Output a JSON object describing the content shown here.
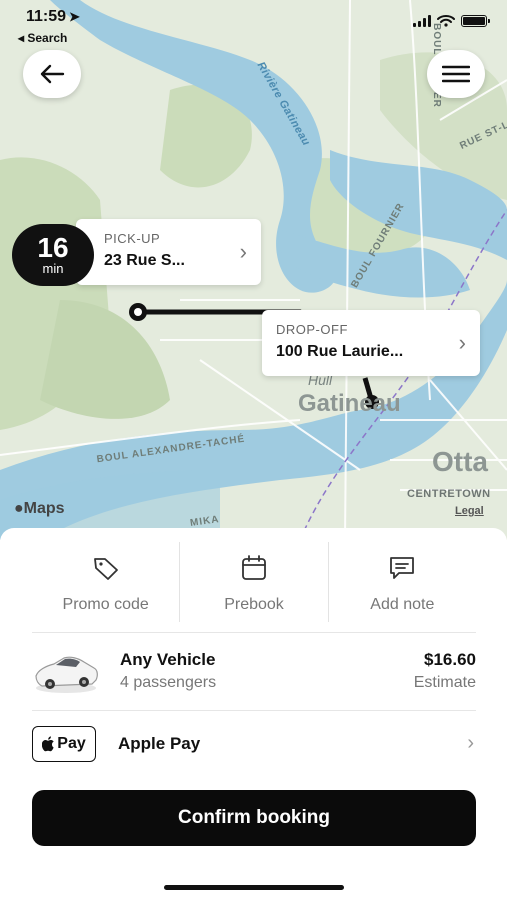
{
  "status_bar": {
    "time": "11:59",
    "back_app": "◂ Search"
  },
  "map": {
    "labels": {
      "river": "Rivière Gatineau",
      "boul_greber": "BOUL GRÉBER",
      "rue_st": "RUE ST-L",
      "boul_fournier": "BOUL FOURNIER",
      "boul_alexandre": "BOUL ALEXANDRE-TACHÉ",
      "hull": "Hull",
      "gatineau": "Gatineau",
      "ottawa": "Otta",
      "centretown": "CENTRETOWN",
      "mikan": "MIKA"
    },
    "maps_logo": "Maps",
    "legal": "Legal"
  },
  "route": {
    "eta_value": "16",
    "eta_unit": "min",
    "pickup_caption": "PICK-UP",
    "pickup_address": "23 Rue S...",
    "dropoff_caption": "DROP-OFF",
    "dropoff_address": "100 Rue Laurie..."
  },
  "actions": [
    {
      "label": "Promo code",
      "icon": "tag-icon"
    },
    {
      "label": "Prebook",
      "icon": "calendar-icon"
    },
    {
      "label": "Add note",
      "icon": "message-icon"
    }
  ],
  "vehicle": {
    "name": "Any Vehicle",
    "passengers": "4 passengers",
    "price": "$16.60",
    "price_note": "Estimate"
  },
  "payment": {
    "badge": "Pay",
    "method": "Apple Pay"
  },
  "confirm_label": "Confirm booking",
  "colors": {
    "accent": "#0b0b0b",
    "water": "#9fcbe0",
    "park": "#cbdcba",
    "land": "#e4ebdd"
  }
}
